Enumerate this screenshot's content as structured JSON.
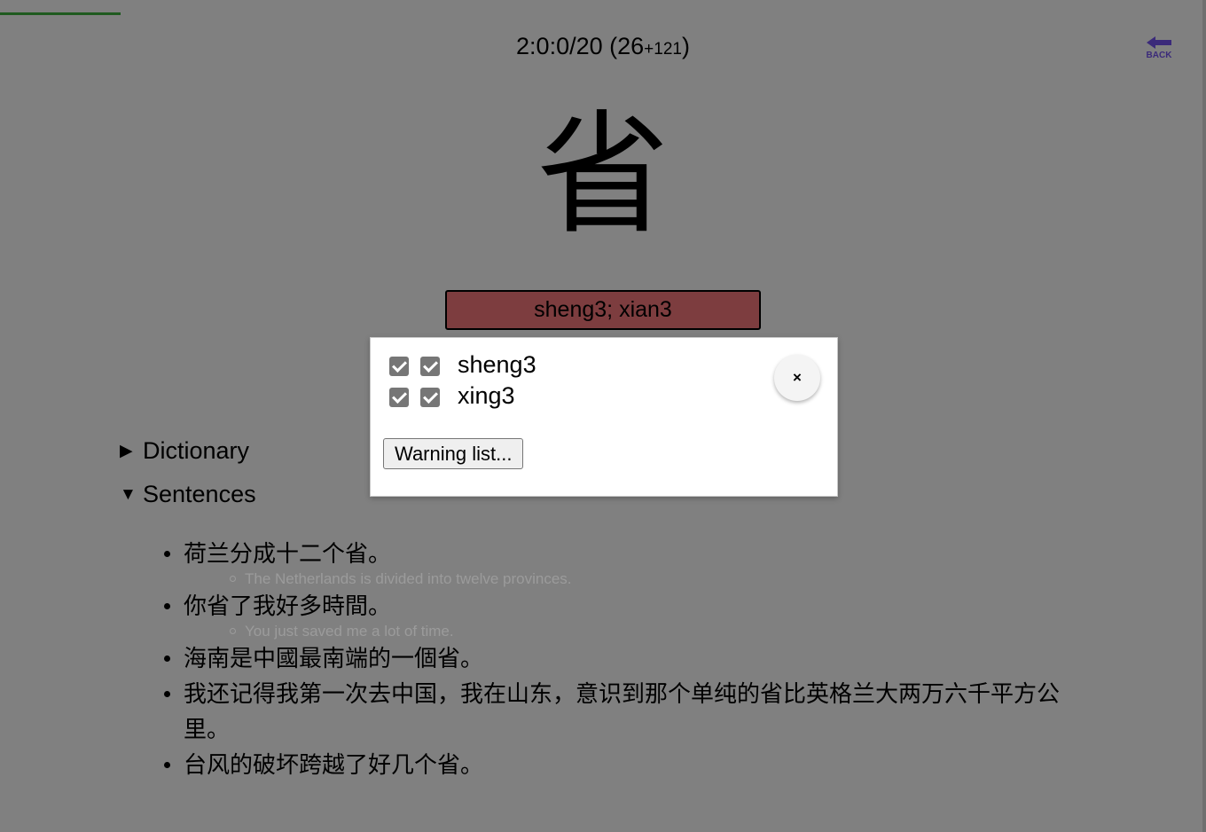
{
  "progress": {
    "fraction": 0.1
  },
  "status": {
    "main": "2:0:0/20 (26",
    "small": "+121",
    "close": ")"
  },
  "back_button": {
    "label": "BACK",
    "icon": "arrow-left-icon",
    "color": "#3b2a7a"
  },
  "character": "省",
  "answer": {
    "text": "sheng3; xian3",
    "background": "#7d3d3f"
  },
  "sections": {
    "dictionary": {
      "arrow": "▶",
      "label": "Dictionary"
    },
    "sentences": {
      "arrow": "▼",
      "label": "Sentences"
    }
  },
  "sentences": [
    {
      "text": "荷兰分成十二个省。",
      "translation": "The Netherlands is divided into twelve provinces."
    },
    {
      "text": "你省了我好多時間。",
      "translation": "You just saved me a lot of time."
    },
    {
      "text": "海南是中國最南端的一個省。"
    },
    {
      "text": "我还记得我第一次去中国，我在山东，意识到那个单纯的省比英格兰大两万六千平方公里。"
    },
    {
      "text": "台风的破坏跨越了好几个省。"
    }
  ],
  "popup": {
    "items": [
      {
        "pinyin": "sheng3",
        "checked_a": true,
        "checked_b": true
      },
      {
        "pinyin": "xing3",
        "checked_a": true,
        "checked_b": true
      }
    ],
    "close_label": "×",
    "warning_button": "Warning list..."
  }
}
